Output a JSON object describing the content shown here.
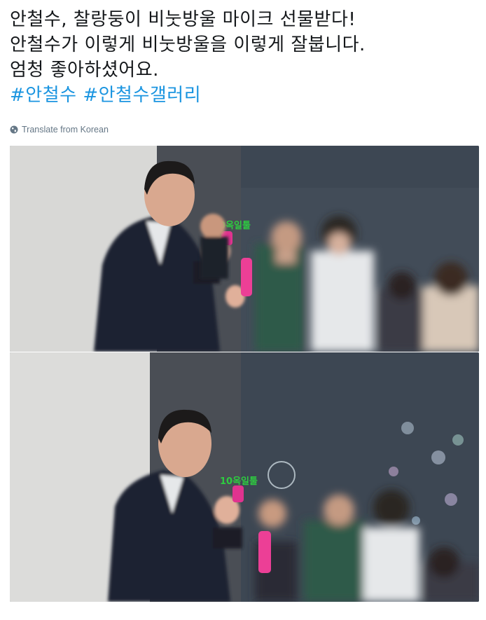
{
  "tweet": {
    "lines": [
      "안철수, 찰랑둥이 비눗방울 마이크 선물받다!",
      "안철수가 이렇게 비눗방울을 이렇게 잘붑니다.",
      "엄청 좋아하셨어요."
    ],
    "hashtags": [
      "#안철수",
      "#안철수갤러리"
    ],
    "translate_label": "Translate from Korean"
  },
  "photos": [
    {
      "sticker_text": "10옥일툴"
    },
    {
      "sticker_text": "10옥일툴"
    }
  ],
  "colors": {
    "text": "#14171a",
    "hashtag": "#1b95e0",
    "meta": "#657786"
  }
}
